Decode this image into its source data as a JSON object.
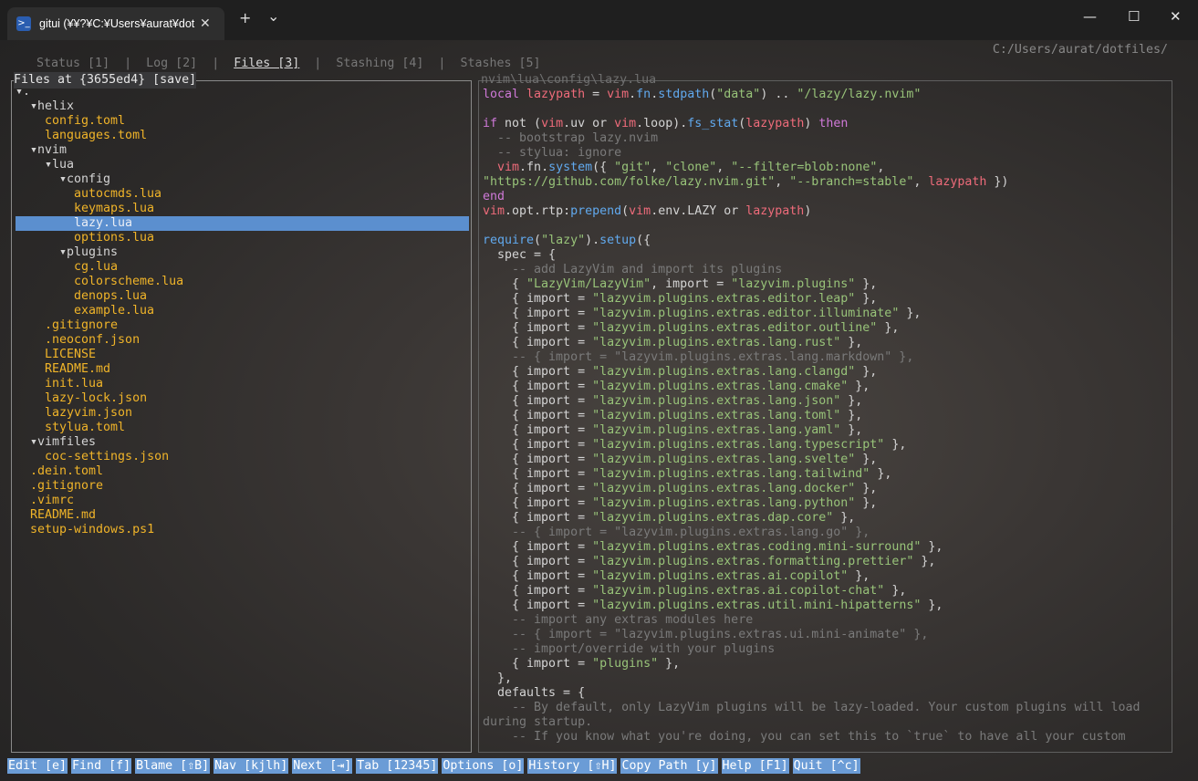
{
  "window": {
    "tab_title": "gitui (¥¥?¥C:¥Users¥aurat¥dot",
    "tab_close": "✕",
    "new_tab": "+",
    "dropdown": "⌄",
    "minimize": "—",
    "maximize": "☐",
    "close": "✕"
  },
  "nav": {
    "tabs": [
      "Status [1]",
      "Log [2]",
      "Files [3]",
      "Stashing [4]",
      "Stashes [5]"
    ],
    "separator": "|",
    "cwd": "C:/Users/aurat/dotfiles/"
  },
  "files_panel": {
    "title": "Files at {3655ed4} [save]",
    "tree": [
      {
        "text": "▾.",
        "kind": "dir",
        "indent": 0
      },
      {
        "text": "▾helix",
        "kind": "dir",
        "indent": 1
      },
      {
        "text": "config.toml",
        "kind": "file",
        "indent": 2
      },
      {
        "text": "languages.toml",
        "kind": "file",
        "indent": 2
      },
      {
        "text": "▾nvim",
        "kind": "dir",
        "indent": 1
      },
      {
        "text": "▾lua",
        "kind": "dir",
        "indent": 2
      },
      {
        "text": "▾config",
        "kind": "dir",
        "indent": 3
      },
      {
        "text": "autocmds.lua",
        "kind": "file",
        "indent": 4
      },
      {
        "text": "keymaps.lua",
        "kind": "file",
        "indent": 4
      },
      {
        "text": "lazy.lua",
        "kind": "file",
        "indent": 4,
        "selected": true
      },
      {
        "text": "options.lua",
        "kind": "file",
        "indent": 4
      },
      {
        "text": "▾plugins",
        "kind": "dir",
        "indent": 3
      },
      {
        "text": "cg.lua",
        "kind": "file",
        "indent": 4
      },
      {
        "text": "colorscheme.lua",
        "kind": "file",
        "indent": 4
      },
      {
        "text": "denops.lua",
        "kind": "file",
        "indent": 4
      },
      {
        "text": "example.lua",
        "kind": "file",
        "indent": 4
      },
      {
        "text": ".gitignore",
        "kind": "file",
        "indent": 2
      },
      {
        "text": ".neoconf.json",
        "kind": "file",
        "indent": 2
      },
      {
        "text": "LICENSE",
        "kind": "file",
        "indent": 2
      },
      {
        "text": "README.md",
        "kind": "file",
        "indent": 2
      },
      {
        "text": "init.lua",
        "kind": "file",
        "indent": 2
      },
      {
        "text": "lazy-lock.json",
        "kind": "file",
        "indent": 2
      },
      {
        "text": "lazyvim.json",
        "kind": "file",
        "indent": 2
      },
      {
        "text": "stylua.toml",
        "kind": "file",
        "indent": 2
      },
      {
        "text": "▾vimfiles",
        "kind": "dir",
        "indent": 1
      },
      {
        "text": "coc-settings.json",
        "kind": "file",
        "indent": 2
      },
      {
        "text": ".dein.toml",
        "kind": "file",
        "indent": 1
      },
      {
        "text": ".gitignore",
        "kind": "file",
        "indent": 1
      },
      {
        "text": ".vimrc",
        "kind": "file",
        "indent": 1
      },
      {
        "text": "README.md",
        "kind": "file",
        "indent": 1
      },
      {
        "text": "setup-windows.ps1",
        "kind": "file",
        "indent": 1
      }
    ]
  },
  "preview_panel": {
    "title": "nvim\\lua\\config\\lazy.lua",
    "lines": [
      [
        [
          "kw",
          "local "
        ],
        [
          "var",
          "lazypath"
        ],
        [
          "pl",
          " = "
        ],
        [
          "var",
          "vim"
        ],
        [
          "pl",
          "."
        ],
        [
          "fn",
          "fn"
        ],
        [
          "pl",
          "."
        ],
        [
          "fn",
          "stdpath"
        ],
        [
          "pl",
          "("
        ],
        [
          "str",
          "\"data\""
        ],
        [
          "pl",
          ") .. "
        ],
        [
          "str",
          "\"/lazy/lazy.nvim\""
        ]
      ],
      [],
      [
        [
          "kw",
          "if"
        ],
        [
          "pl",
          " not ("
        ],
        [
          "var",
          "vim"
        ],
        [
          "pl",
          ".uv or "
        ],
        [
          "var",
          "vim"
        ],
        [
          "pl",
          ".loop)."
        ],
        [
          "fn",
          "fs_stat"
        ],
        [
          "pl",
          "("
        ],
        [
          "var",
          "lazypath"
        ],
        [
          "pl",
          ") "
        ],
        [
          "kw",
          "then"
        ]
      ],
      [
        [
          "cm",
          "  -- bootstrap lazy.nvim"
        ]
      ],
      [
        [
          "cm",
          "  -- stylua: ignore"
        ]
      ],
      [
        [
          "pl",
          "  "
        ],
        [
          "var",
          "vim"
        ],
        [
          "pl",
          ".fn."
        ],
        [
          "fn",
          "system"
        ],
        [
          "pl",
          "({ "
        ],
        [
          "str",
          "\"git\""
        ],
        [
          "pl",
          ", "
        ],
        [
          "str",
          "\"clone\""
        ],
        [
          "pl",
          ", "
        ],
        [
          "str",
          "\"--filter=blob:none\""
        ],
        [
          "pl",
          ","
        ]
      ],
      [
        [
          "str",
          "\"https://github.com/folke/lazy.nvim.git\""
        ],
        [
          "pl",
          ", "
        ],
        [
          "str",
          "\"--branch=stable\""
        ],
        [
          "pl",
          ", "
        ],
        [
          "var",
          "lazypath"
        ],
        [
          "pl",
          " })"
        ]
      ],
      [
        [
          "kw",
          "end"
        ]
      ],
      [
        [
          "var",
          "vim"
        ],
        [
          "pl",
          ".opt.rtp:"
        ],
        [
          "fn",
          "prepend"
        ],
        [
          "pl",
          "("
        ],
        [
          "var",
          "vim"
        ],
        [
          "pl",
          ".env.LAZY or "
        ],
        [
          "var",
          "lazypath"
        ],
        [
          "pl",
          ")"
        ]
      ],
      [],
      [
        [
          "fn",
          "require"
        ],
        [
          "pl",
          "("
        ],
        [
          "str",
          "\"lazy\""
        ],
        [
          "pl",
          ")."
        ],
        [
          "fn",
          "setup"
        ],
        [
          "pl",
          "({"
        ]
      ],
      [
        [
          "pl",
          "  spec = {"
        ]
      ],
      [
        [
          "cm",
          "    -- add LazyVim and import its plugins"
        ]
      ],
      [
        [
          "pl",
          "    { "
        ],
        [
          "str",
          "\"LazyVim/LazyVim\""
        ],
        [
          "pl",
          ", import = "
        ],
        [
          "str",
          "\"lazyvim.plugins\""
        ],
        [
          "pl",
          " },"
        ]
      ],
      [
        [
          "pl",
          "    { import = "
        ],
        [
          "str",
          "\"lazyvim.plugins.extras.editor.leap\""
        ],
        [
          "pl",
          " },"
        ]
      ],
      [
        [
          "pl",
          "    { import = "
        ],
        [
          "str",
          "\"lazyvim.plugins.extras.editor.illuminate\""
        ],
        [
          "pl",
          " },"
        ]
      ],
      [
        [
          "pl",
          "    { import = "
        ],
        [
          "str",
          "\"lazyvim.plugins.extras.editor.outline\""
        ],
        [
          "pl",
          " },"
        ]
      ],
      [
        [
          "pl",
          "    { import = "
        ],
        [
          "str",
          "\"lazyvim.plugins.extras.lang.rust\""
        ],
        [
          "pl",
          " },"
        ]
      ],
      [
        [
          "cm",
          "    -- { import = \"lazyvim.plugins.extras.lang.markdown\" },"
        ]
      ],
      [
        [
          "pl",
          "    { import = "
        ],
        [
          "str",
          "\"lazyvim.plugins.extras.lang.clangd\""
        ],
        [
          "pl",
          " },"
        ]
      ],
      [
        [
          "pl",
          "    { import = "
        ],
        [
          "str",
          "\"lazyvim.plugins.extras.lang.cmake\""
        ],
        [
          "pl",
          " },"
        ]
      ],
      [
        [
          "pl",
          "    { import = "
        ],
        [
          "str",
          "\"lazyvim.plugins.extras.lang.json\""
        ],
        [
          "pl",
          " },"
        ]
      ],
      [
        [
          "pl",
          "    { import = "
        ],
        [
          "str",
          "\"lazyvim.plugins.extras.lang.toml\""
        ],
        [
          "pl",
          " },"
        ]
      ],
      [
        [
          "pl",
          "    { import = "
        ],
        [
          "str",
          "\"lazyvim.plugins.extras.lang.yaml\""
        ],
        [
          "pl",
          " },"
        ]
      ],
      [
        [
          "pl",
          "    { import = "
        ],
        [
          "str",
          "\"lazyvim.plugins.extras.lang.typescript\""
        ],
        [
          "pl",
          " },"
        ]
      ],
      [
        [
          "pl",
          "    { import = "
        ],
        [
          "str",
          "\"lazyvim.plugins.extras.lang.svelte\""
        ],
        [
          "pl",
          " },"
        ]
      ],
      [
        [
          "pl",
          "    { import = "
        ],
        [
          "str",
          "\"lazyvim.plugins.extras.lang.tailwind\""
        ],
        [
          "pl",
          " },"
        ]
      ],
      [
        [
          "pl",
          "    { import = "
        ],
        [
          "str",
          "\"lazyvim.plugins.extras.lang.docker\""
        ],
        [
          "pl",
          " },"
        ]
      ],
      [
        [
          "pl",
          "    { import = "
        ],
        [
          "str",
          "\"lazyvim.plugins.extras.lang.python\""
        ],
        [
          "pl",
          " },"
        ]
      ],
      [
        [
          "pl",
          "    { import = "
        ],
        [
          "str",
          "\"lazyvim.plugins.extras.dap.core\""
        ],
        [
          "pl",
          " },"
        ]
      ],
      [
        [
          "cm",
          "    -- { import = \"lazyvim.plugins.extras.lang.go\" },"
        ]
      ],
      [
        [
          "pl",
          "    { import = "
        ],
        [
          "str",
          "\"lazyvim.plugins.extras.coding.mini-surround\""
        ],
        [
          "pl",
          " },"
        ]
      ],
      [
        [
          "pl",
          "    { import = "
        ],
        [
          "str",
          "\"lazyvim.plugins.extras.formatting.prettier\""
        ],
        [
          "pl",
          " },"
        ]
      ],
      [
        [
          "pl",
          "    { import = "
        ],
        [
          "str",
          "\"lazyvim.plugins.extras.ai.copilot\""
        ],
        [
          "pl",
          " },"
        ]
      ],
      [
        [
          "pl",
          "    { import = "
        ],
        [
          "str",
          "\"lazyvim.plugins.extras.ai.copilot-chat\""
        ],
        [
          "pl",
          " },"
        ]
      ],
      [
        [
          "pl",
          "    { import = "
        ],
        [
          "str",
          "\"lazyvim.plugins.extras.util.mini-hipatterns\""
        ],
        [
          "pl",
          " },"
        ]
      ],
      [
        [
          "cm",
          "    -- import any extras modules here"
        ]
      ],
      [
        [
          "cm",
          "    -- { import = \"lazyvim.plugins.extras.ui.mini-animate\" },"
        ]
      ],
      [
        [
          "cm",
          "    -- import/override with your plugins"
        ]
      ],
      [
        [
          "pl",
          "    { import = "
        ],
        [
          "str",
          "\"plugins\""
        ],
        [
          "pl",
          " },"
        ]
      ],
      [
        [
          "pl",
          "  },"
        ]
      ],
      [
        [
          "pl",
          "  defaults = {"
        ]
      ],
      [
        [
          "cm",
          "    -- By default, only LazyVim plugins will be lazy-loaded. Your custom plugins will load"
        ]
      ],
      [
        [
          "cm",
          "during startup."
        ]
      ],
      [
        [
          "cm",
          "    -- If you know what you're doing, you can set this to `true` to have all your custom"
        ]
      ]
    ]
  },
  "bottom_commands": [
    "Edit [e]",
    "Find [f]",
    "Blame [⇧B]",
    "Nav [kjlh]",
    "Next [⇥]",
    "Tab [12345]",
    "Options [o]",
    "History [⇧H]",
    "Copy Path [y]",
    "Help [F1]",
    "Quit [^c]"
  ]
}
